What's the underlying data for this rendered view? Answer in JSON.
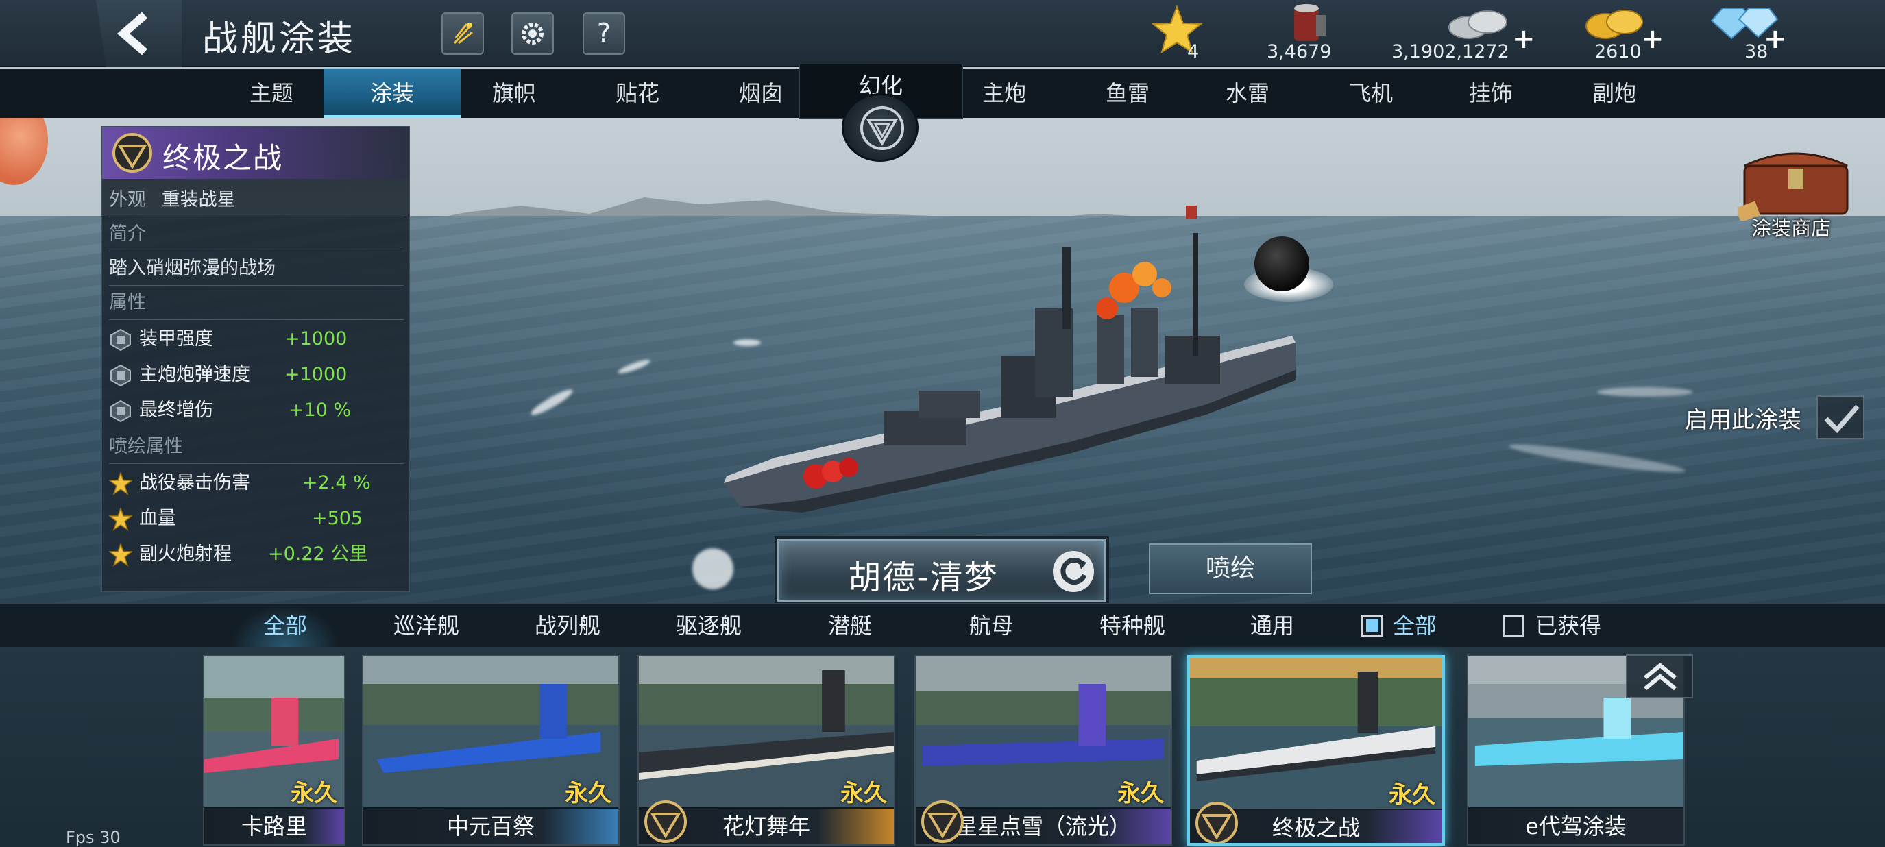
{
  "header": {
    "title": "战舰涂装",
    "back_icon": "back-arrow-icon",
    "buttons": [
      "fireworks-icon",
      "gear-icon",
      "help-icon"
    ],
    "help_label": "?"
  },
  "resources": [
    {
      "name": "star",
      "icon": "star-icon",
      "value": "4",
      "has_plus": false
    },
    {
      "name": "paint",
      "icon": "paint-bucket-icon",
      "value": "3,4679",
      "has_plus": false
    },
    {
      "name": "silver",
      "icon": "silver-coin-icon",
      "value": "3,1902,1272",
      "has_plus": true
    },
    {
      "name": "gold",
      "icon": "gold-coin-icon",
      "value": "2610",
      "has_plus": true
    },
    {
      "name": "diamond",
      "icon": "diamond-icon",
      "value": "38",
      "has_plus": true
    }
  ],
  "tabs": {
    "left": [
      "主题",
      "涂装",
      "旗帜",
      "贴花",
      "烟囱"
    ],
    "center": "幻化",
    "right": [
      "主炮",
      "鱼雷",
      "水雷",
      "飞机",
      "挂饰",
      "副炮"
    ],
    "active": "涂装"
  },
  "panel": {
    "name": "终极之战",
    "look_label": "外观",
    "look_value": "重装战星",
    "intro_label": "简介",
    "intro_text": "踏入硝烟弥漫的战场",
    "attr_label": "属性",
    "attrs": [
      {
        "label": "装甲强度",
        "value": "+1000"
      },
      {
        "label": "主炮炮弹速度",
        "value": "+1000"
      },
      {
        "label": "最终增伤",
        "value": "+10 %"
      }
    ],
    "spray_label": "喷绘属性",
    "spray_attrs": [
      {
        "label": "战役暴击伤害",
        "value": "+2.4 %"
      },
      {
        "label": "血量",
        "value": "+505"
      },
      {
        "label": "副火炮射程",
        "value": "+0.22 公里"
      }
    ]
  },
  "store": {
    "label": "涂装商店",
    "icon": "treasure-chest-icon"
  },
  "enable": {
    "label": "启用此涂装",
    "icon": "checkmark-icon"
  },
  "ship_name": "胡德-清梦",
  "spray_button": "喷绘",
  "filters": {
    "categories": [
      "全部",
      "巡洋舰",
      "战列舰",
      "驱逐舰",
      "潜艇",
      "航母",
      "特种舰",
      "通用"
    ],
    "active": "全部",
    "check_all": "全部",
    "check_owned": "已获得"
  },
  "cards": [
    {
      "name": "卡路里",
      "perm": "永久",
      "rarity": "#5b45a8",
      "theme": "pink",
      "emblem": false
    },
    {
      "name": "中元百祭",
      "perm": "永久",
      "rarity": "#3a7fb8",
      "theme": "blue",
      "emblem": false
    },
    {
      "name": "花灯舞年",
      "perm": "永久",
      "rarity": "#c7862a",
      "theme": "dark",
      "emblem": true
    },
    {
      "name": "星星点雪（流光）",
      "perm": "永久",
      "rarity": "#5b45a8",
      "theme": "purple",
      "emblem": true
    },
    {
      "name": "终极之战",
      "perm": "永久",
      "rarity": "#5b45a8",
      "theme": "grey",
      "emblem": true
    },
    {
      "name": "e代驾涂装",
      "perm": "",
      "rarity": "#1c2731",
      "theme": "cyan",
      "emblem": false
    }
  ],
  "fps": "Fps 30",
  "colors": {
    "accent": "#5ed0ee",
    "green_value": "#7fe24a",
    "gold": "#ffd84a",
    "purple_rarity": "#5b45a8"
  }
}
